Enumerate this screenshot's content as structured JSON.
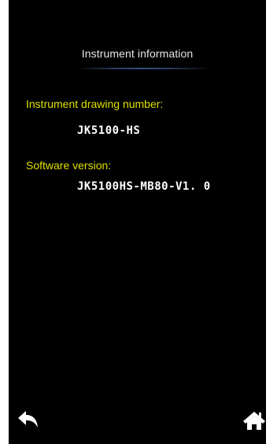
{
  "header": {
    "title": "Instrument information"
  },
  "fields": {
    "drawing_number": {
      "label": "Instrument drawing number:",
      "value": "JK5100-HS"
    },
    "software_version": {
      "label": "Software version:",
      "value": "JK5100HS-MB80-V1. 0"
    }
  },
  "navigation": {
    "back_icon": "back-arrow-icon",
    "home_icon": "home-icon"
  },
  "colors": {
    "background": "#000000",
    "label": "#e0e000",
    "value": "#ffffff",
    "title": "#e6e6e6",
    "divider": "#34507e"
  }
}
